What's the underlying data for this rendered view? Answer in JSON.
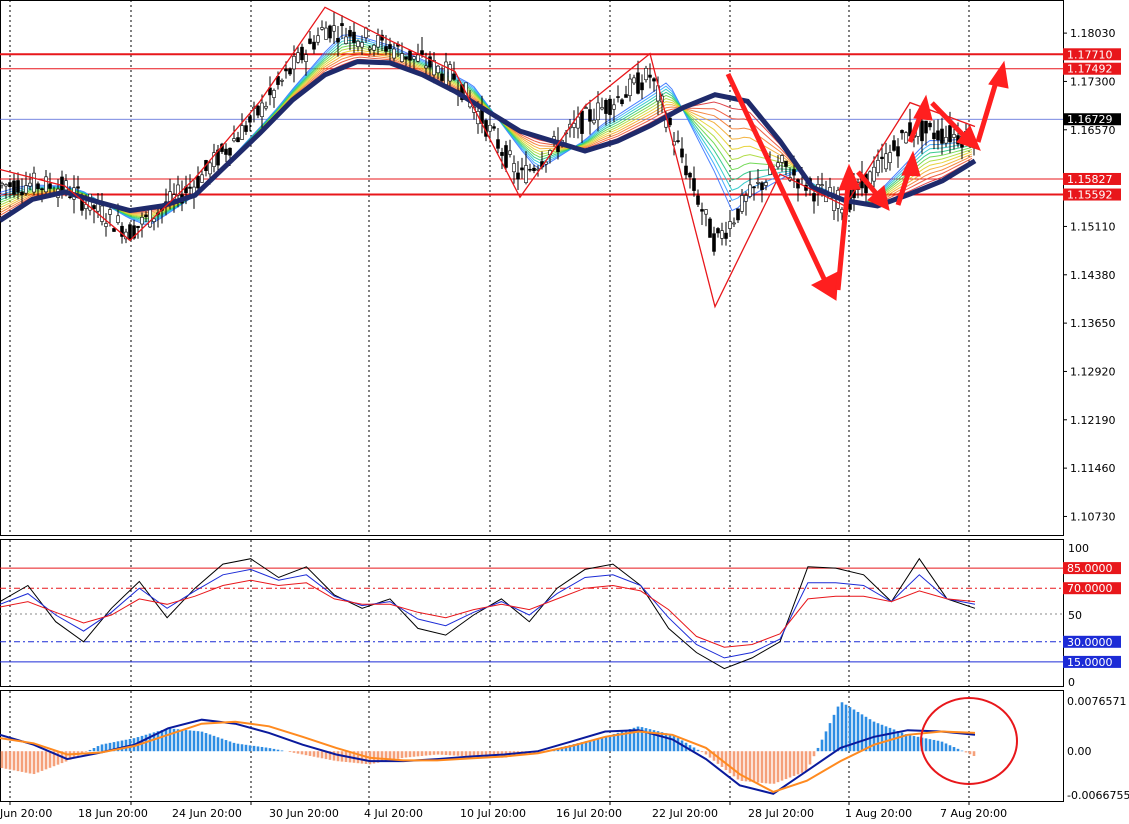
{
  "chart_data": [
    {
      "panel": "price",
      "type": "candlestick",
      "y_ticks": [
        "1.18030",
        "1.17300",
        "1.16570",
        "1.15110",
        "1.14380",
        "1.13650",
        "1.12920",
        "1.12190",
        "1.11460",
        "1.10730"
      ],
      "ylim": [
        1.1045,
        1.1853
      ],
      "price_levels": [
        {
          "label": "1.17710",
          "value": 1.1771
        },
        {
          "label": "1.17492",
          "value": 1.17492
        },
        {
          "label": "1.15827",
          "value": 1.15827
        },
        {
          "label": "1.15592",
          "value": 1.15592
        }
      ],
      "current_price": {
        "label": "1.16729",
        "value": 1.16729
      },
      "x_ticks": [
        "Jun 20:00",
        "18 Jun 20:00",
        "24 Jun 20:00",
        "30 Jun 20:00",
        "4 Jul 20:00",
        "10 Jul 20:00",
        "16 Jul 20:00",
        "22 Jul 20:00",
        "28 Jul 20:00",
        "1 Aug 20:00",
        "7 Aug 20:00"
      ],
      "ma_slow_series": [
        1.152,
        1.1552,
        1.1563,
        1.1548,
        1.1535,
        1.1542,
        1.1558,
        1.1605,
        1.1652,
        1.1702,
        1.174,
        1.176,
        1.1758,
        1.174,
        1.1715,
        1.1685,
        1.1655,
        1.164,
        1.1625,
        1.164,
        1.1663,
        1.169,
        1.171,
        1.17,
        1.164,
        1.157,
        1.155,
        1.1542,
        1.156,
        1.158,
        1.161
      ],
      "swing_polyline": [
        1.1597,
        1.1572,
        1.149,
        1.1584,
        1.17,
        1.1842,
        1.1792,
        1.1745,
        1.1555,
        1.1693,
        1.1772,
        1.139,
        1.159,
        1.1542,
        1.1698,
        1.1662
      ]
    },
    {
      "panel": "oscillator",
      "type": "line",
      "y_ticks": [
        "100",
        "50",
        "0"
      ],
      "ylim": [
        0,
        100
      ],
      "levels": [
        {
          "label": "85.0000",
          "value": 85
        },
        {
          "label": "70.0000",
          "value": 70
        },
        {
          "label": "30.0000",
          "value": 30
        },
        {
          "label": "15.0000",
          "value": 15
        }
      ],
      "series": [
        {
          "values": [
            60,
            72,
            45,
            30,
            55,
            75,
            48,
            70,
            88,
            92,
            78,
            86,
            65,
            55,
            62,
            40,
            35,
            50,
            62,
            45,
            70,
            84,
            88,
            72,
            40,
            22,
            10,
            18,
            30,
            86,
            85,
            80,
            60,
            92,
            62,
            55
          ]
        },
        {
          "values": [
            58,
            66,
            50,
            38,
            52,
            70,
            55,
            68,
            80,
            84,
            76,
            80,
            64,
            57,
            60,
            47,
            42,
            52,
            60,
            50,
            66,
            78,
            80,
            72,
            48,
            28,
            18,
            22,
            32,
            74,
            74,
            72,
            60,
            80,
            62,
            58
          ]
        },
        {
          "values": [
            56,
            60,
            52,
            44,
            50,
            62,
            58,
            64,
            72,
            76,
            72,
            74,
            62,
            58,
            58,
            52,
            48,
            54,
            58,
            54,
            62,
            70,
            72,
            68,
            54,
            34,
            26,
            28,
            36,
            62,
            64,
            64,
            60,
            68,
            62,
            60
          ]
        }
      ]
    },
    {
      "panel": "macd",
      "type": "bar",
      "y_ticks": [
        "0.0076571",
        "0.00",
        "-0.0066755"
      ],
      "ylim": [
        -0.0066755,
        0.0076571
      ],
      "histogram": [
        -0.0025,
        -0.0035,
        -0.0015,
        0.001,
        0.002,
        0.0035,
        0.003,
        0.0012,
        0.0005,
        -0.0005,
        -0.0015,
        -0.002,
        -0.001,
        -0.0005,
        -0.0008,
        -0.001,
        -0.0003,
        0.001,
        0.0022,
        0.0038,
        0.0025,
        -0.0005,
        -0.0045,
        -0.005,
        -0.003,
        0.0076,
        0.0045,
        0.0025,
        0.0015,
        -0.0008
      ],
      "signal_blue": [
        0.0025,
        0.001,
        -0.0012,
        -0.0002,
        0.001,
        0.0035,
        0.0048,
        0.0042,
        0.0028,
        0.001,
        -0.0005,
        -0.0015,
        -0.0015,
        -0.0012,
        -0.0008,
        -0.0005,
        0.0,
        0.0015,
        0.003,
        0.0032,
        0.0018,
        -0.0012,
        -0.0052,
        -0.0065,
        -0.003,
        0.0005,
        0.0022,
        0.0032,
        0.003,
        0.0025
      ],
      "signal_orange": [
        0.002,
        0.0012,
        -0.0005,
        -0.0002,
        0.0008,
        0.0025,
        0.0042,
        0.0045,
        0.0038,
        0.0022,
        0.0005,
        -0.001,
        -0.0014,
        -0.0014,
        -0.0011,
        -0.0008,
        -0.0003,
        0.0008,
        0.0022,
        0.003,
        0.0025,
        0.0005,
        -0.0035,
        -0.0062,
        -0.0045,
        -0.0015,
        0.001,
        0.0025,
        0.003,
        0.0028
      ]
    }
  ]
}
